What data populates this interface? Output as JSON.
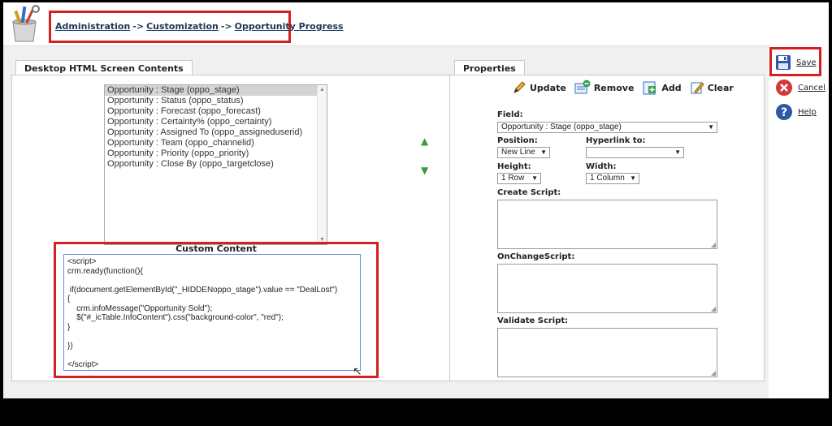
{
  "breadcrumb": {
    "items": [
      "Administration",
      "Customization",
      "Opportunity Progress"
    ],
    "separator": "->"
  },
  "left_panel": {
    "tab_label": "Desktop HTML Screen Contents",
    "fields": [
      "Opportunity : Stage (oppo_stage)",
      "Opportunity : Status (oppo_status)",
      "Opportunity : Forecast (oppo_forecast)",
      "Opportunity : Certainty% (oppo_certainty)",
      "Opportunity : Assigned To (oppo_assigneduserid)",
      "Opportunity : Team (oppo_channelid)",
      "Opportunity : Priority (oppo_priority)",
      "Opportunity : Close By (oppo_targetclose)"
    ],
    "selected_index": 0,
    "custom_content_label": "Custom Content",
    "custom_content": "<script>\ncrm.ready(function(){\n\n if(document.getElementById(\"_HIDDENoppo_stage\").value == \"DealLost\")\n{\n    crm.infoMessage(\"Opportunity Sold\");\n    $(\"#_icTable.InfoContent\").css(\"background-color\", \"red\");\n}\n\n})\n\n</script>"
  },
  "right_panel": {
    "tab_label": "Properties",
    "toolbar": {
      "update": "Update",
      "remove": "Remove",
      "add": "Add",
      "clear": "Clear"
    },
    "field_label": "Field:",
    "field_value": "Opportunity : Stage (oppo_stage)",
    "position_label": "Position:",
    "position_value": "New Line",
    "hyperlink_label": "Hyperlink to:",
    "hyperlink_value": "",
    "height_label": "Height:",
    "height_value": "1 Row",
    "width_label": "Width:",
    "width_value": "1 Column",
    "create_script_label": "Create Script:",
    "onchange_script_label": "OnChangeScript:",
    "validate_script_label": "Validate Script:"
  },
  "actions": {
    "save": "Save",
    "cancel": "Cancel",
    "help": "Help"
  },
  "colors": {
    "highlight_red": "#d42020",
    "link_navy": "#1d3557",
    "arrow_green": "#3a9a3a"
  }
}
